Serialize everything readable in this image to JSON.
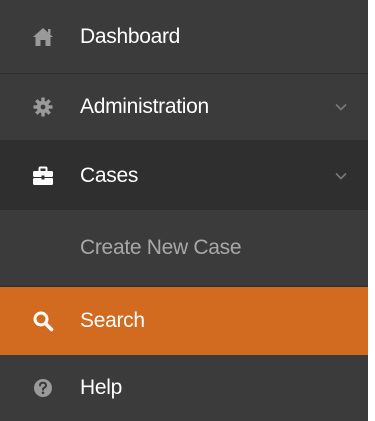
{
  "sidebar": {
    "items": [
      {
        "label": "Dashboard",
        "icon": "home-icon"
      },
      {
        "label": "Administration",
        "icon": "gear-icon",
        "has_submenu": true
      },
      {
        "label": "Cases",
        "icon": "briefcase-icon",
        "has_submenu": true,
        "expanded": true
      },
      {
        "label": "Create New Case",
        "parent": "Cases"
      },
      {
        "label": "Search",
        "icon": "search-icon",
        "active": true
      },
      {
        "label": "Help",
        "icon": "question-circle-icon"
      }
    ]
  },
  "colors": {
    "background": "#3b3b3b",
    "active_bg": "#d26a1f",
    "expanded_bg": "#2f2f2f",
    "text": "#ffffff",
    "subitem_text": "#a8a8a8"
  }
}
